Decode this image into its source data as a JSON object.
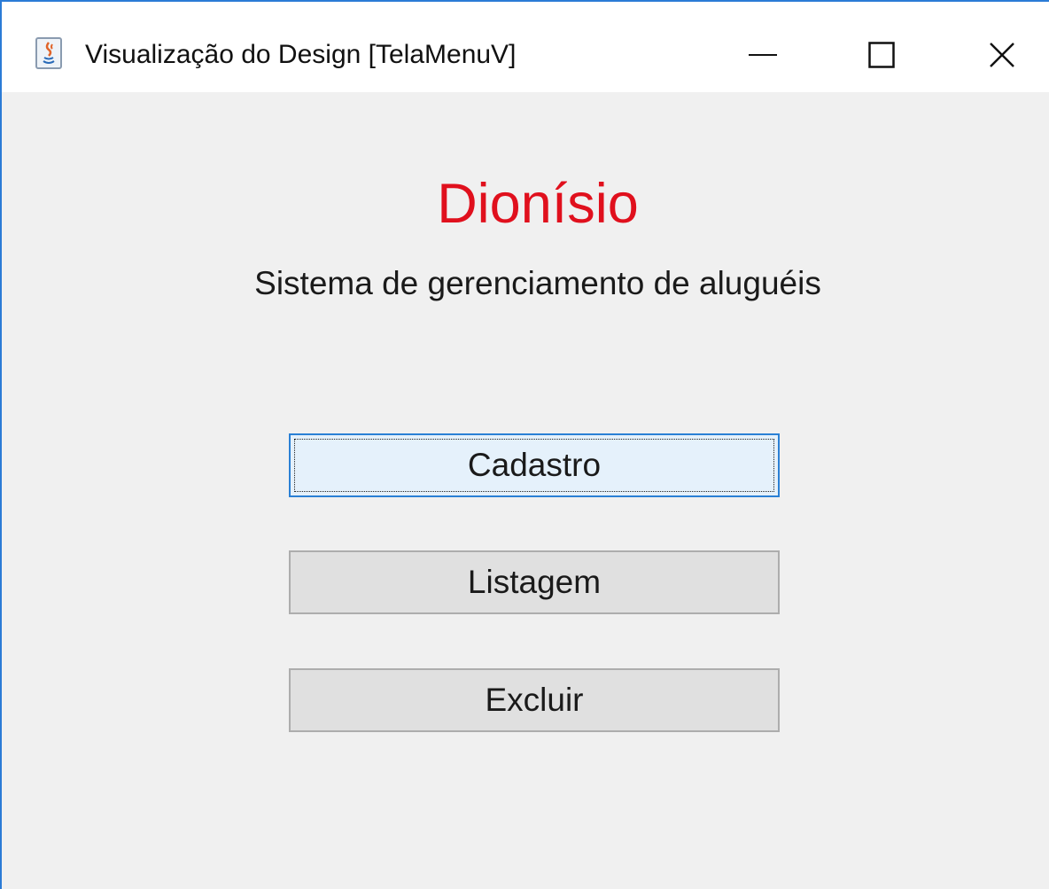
{
  "window": {
    "title": "Visualização do Design [TelaMenuV]",
    "app_icon": "java-icon",
    "controls": {
      "minimize_icon": "minimize-icon",
      "maximize_icon": "maximize-icon",
      "close_icon": "close-icon"
    }
  },
  "main": {
    "app_name": "Dionísio",
    "app_name_color": "#e0101d",
    "subtitle": "Sistema de gerenciamento de aluguéis",
    "buttons": [
      {
        "label": "Cadastro",
        "focused": true
      },
      {
        "label": "Listagem",
        "focused": false
      },
      {
        "label": "Excluir",
        "focused": false
      }
    ]
  },
  "colors": {
    "window_border": "#2b7bd6",
    "content_background": "#f0f0f0",
    "focused_button_border": "#2a80d5",
    "button_background": "#e0e0e0"
  }
}
